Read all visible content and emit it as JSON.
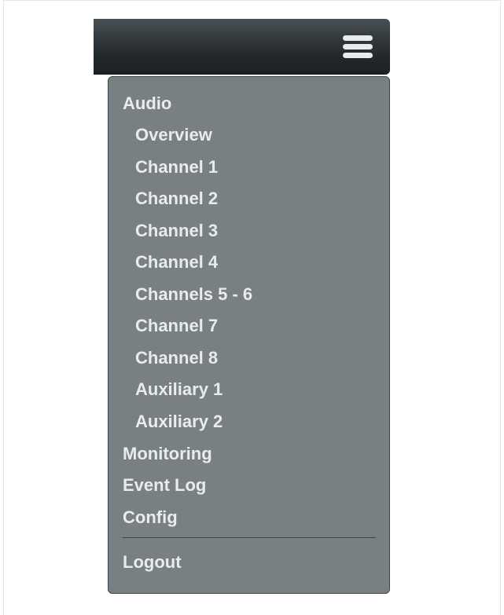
{
  "menu": {
    "items": [
      {
        "label": "Audio"
      },
      {
        "label": "Overview"
      },
      {
        "label": "Channel 1"
      },
      {
        "label": "Channel 2"
      },
      {
        "label": "Channel 3"
      },
      {
        "label": "Channel 4"
      },
      {
        "label": "Channels 5 - 6"
      },
      {
        "label": "Channel 7"
      },
      {
        "label": "Channel 8"
      },
      {
        "label": "Auxiliary 1"
      },
      {
        "label": "Auxiliary 2"
      },
      {
        "label": "Monitoring"
      },
      {
        "label": "Event Log"
      },
      {
        "label": "Config"
      }
    ],
    "logout_label": "Logout"
  },
  "icons": {
    "menu_toggle": "hamburger-menu-icon"
  },
  "colors": {
    "navbar_dark": "#1c2023",
    "dropdown_bg": "#798084",
    "text": "#e9ebec",
    "border": "#3f4649"
  }
}
